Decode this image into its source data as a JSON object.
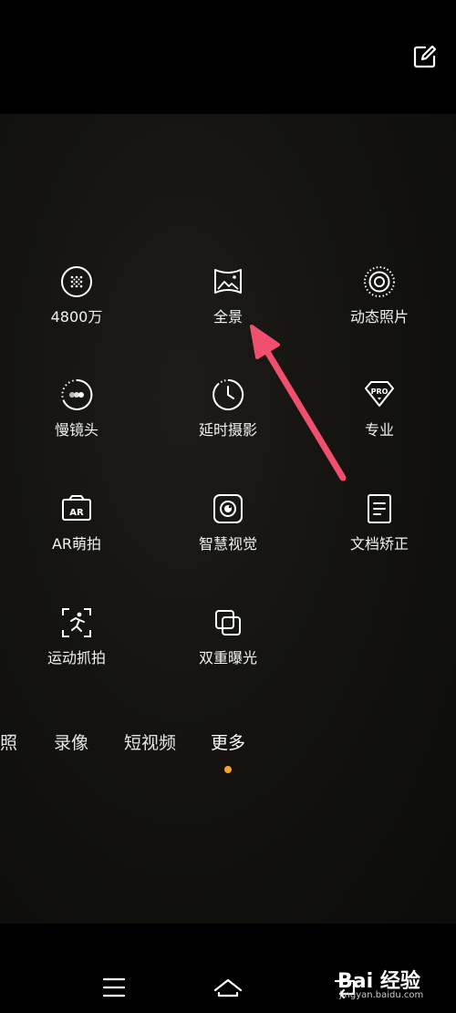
{
  "header": {
    "edit_icon": "edit-icon"
  },
  "modes": [
    {
      "label": "4800万",
      "icon": "48mp-grid-icon"
    },
    {
      "label": "全景",
      "icon": "panorama-icon"
    },
    {
      "label": "动态照片",
      "icon": "live-photo-icon"
    },
    {
      "label": "慢镜头",
      "icon": "slow-motion-icon"
    },
    {
      "label": "延时摄影",
      "icon": "timelapse-icon"
    },
    {
      "label": "专业",
      "icon": "pro-icon"
    },
    {
      "label": "AR萌拍",
      "icon": "ar-icon"
    },
    {
      "label": "智慧视觉",
      "icon": "smart-vision-icon"
    },
    {
      "label": "文档矫正",
      "icon": "document-icon"
    },
    {
      "label": "运动抓拍",
      "icon": "motion-capture-icon"
    },
    {
      "label": "双重曝光",
      "icon": "double-exposure-icon"
    }
  ],
  "tabs": {
    "items": [
      "照",
      "录像",
      "短视频",
      "更多"
    ],
    "active": "更多",
    "active_color": "#f5a623"
  },
  "annotation": {
    "arrow_color": "#f0506e"
  },
  "nav": {
    "menu_icon": "menu-icon",
    "home_icon": "home-icon",
    "back_icon": "back-icon"
  },
  "watermark": {
    "logo": "Bai 经验",
    "url": "jingyan.baidu.com"
  }
}
